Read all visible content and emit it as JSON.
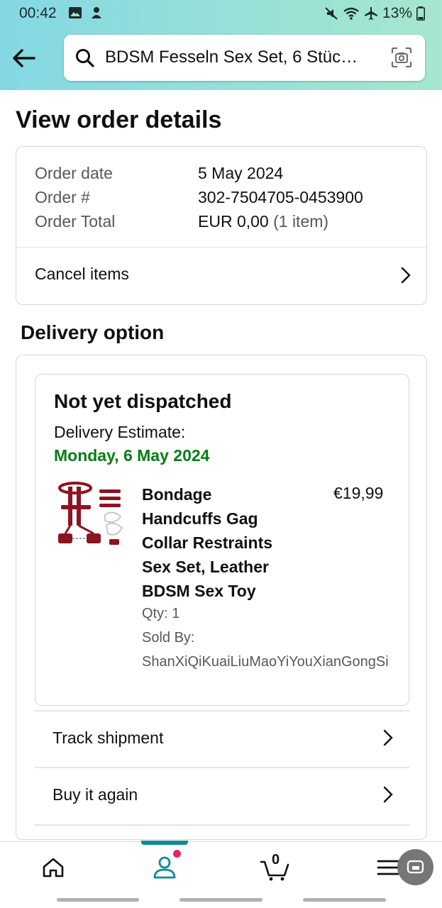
{
  "status_bar": {
    "time": "00:42",
    "battery": "13%"
  },
  "search": {
    "query": "BDSM Fesseln Sex Set, 6 Stüc…"
  },
  "page": {
    "title": "View order details",
    "delivery_heading": "Delivery option"
  },
  "order": {
    "date_label": "Order date",
    "date_value": "5 May 2024",
    "number_label": "Order #",
    "number_value": "302-7504705-0453900",
    "total_label": "Order Total",
    "total_value": "EUR 0,00",
    "total_items": "(1 item)",
    "cancel_label": "Cancel items"
  },
  "shipment": {
    "status": "Not yet dispatched",
    "estimate_label": "Delivery Estimate:",
    "estimate_date": "Monday, 6 May 2024",
    "product_title": "Bondage Handcuffs Gag Collar Restraints Sex Set, Leather BDSM Sex Toy",
    "price": "€19,99",
    "qty": "Qty: 1",
    "sold_by_label": "Sold By:",
    "sold_by_value": "ShanXiQiKuaiLiuMaoYiYouXianGongSi",
    "track_label": "Track shipment",
    "buy_again_label": "Buy it again"
  },
  "nav": {
    "cart_count": "0"
  },
  "colors": {
    "accent": "#0f8a99",
    "estimate_green": "#067d14",
    "badge": "#e7226b"
  }
}
